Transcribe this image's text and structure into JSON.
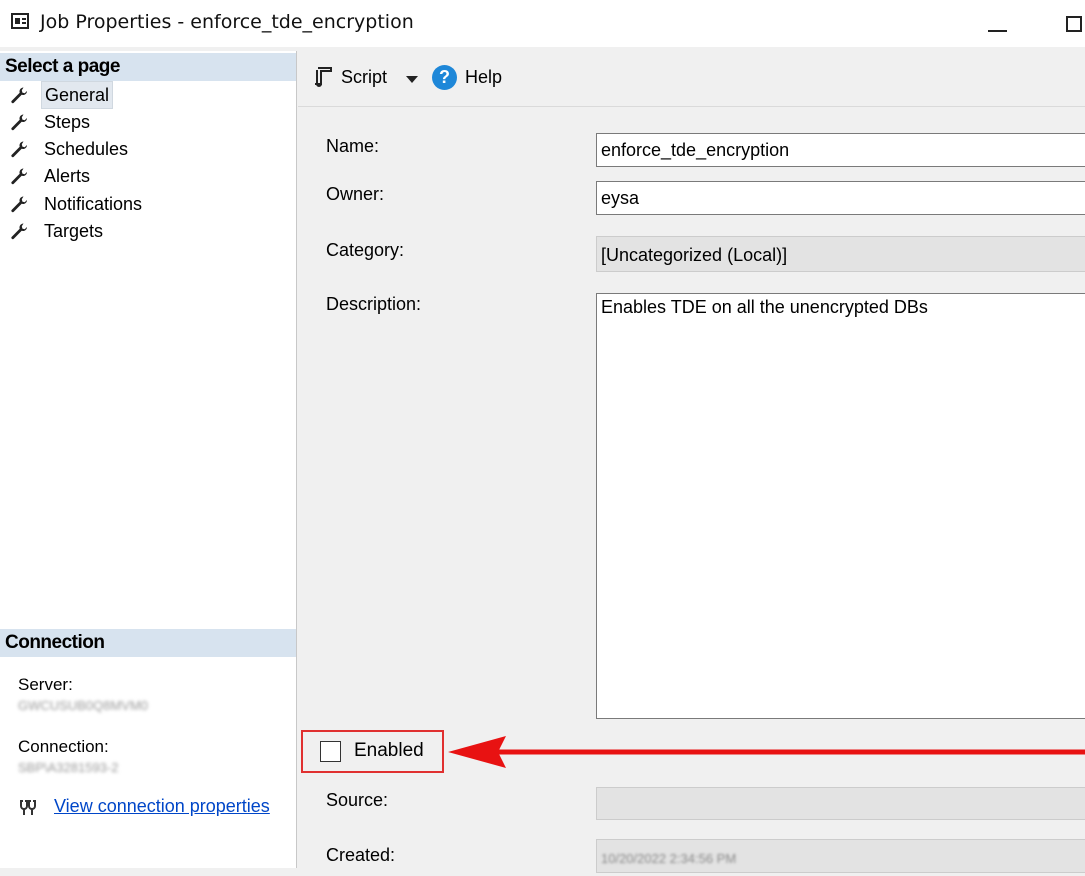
{
  "window": {
    "title": "Job Properties - enforce_tde_encryption"
  },
  "left_pane": {
    "select_page_header": "Select a page",
    "pages": [
      {
        "label": "General",
        "selected": true
      },
      {
        "label": "Steps"
      },
      {
        "label": "Schedules"
      },
      {
        "label": "Alerts"
      },
      {
        "label": "Notifications"
      },
      {
        "label": "Targets"
      }
    ],
    "connection_header": "Connection",
    "server_label": "Server:",
    "server_value": "GWCUSUB0Q8MVM0",
    "connection_label": "Connection:",
    "connection_value": "SBP\\A3281593-2",
    "view_connection_link": "View connection properties"
  },
  "toolbar": {
    "script_label": "Script",
    "help_label": "Help"
  },
  "form": {
    "name_label": "Name:",
    "name_value": "enforce_tde_encryption",
    "owner_label": "Owner:",
    "owner_value": "eysa",
    "category_label": "Category:",
    "category_value": "[Uncategorized (Local)]",
    "description_label": "Description:",
    "description_value": "Enables TDE on all the unencrypted DBs",
    "enabled_label": "Enabled",
    "enabled_checked": false,
    "source_label": "Source:",
    "source_value": "",
    "created_label": "Created:",
    "created_value": "10/20/2022 2:34:56 PM"
  },
  "annotation": {
    "highlight_color": "#e03030"
  }
}
